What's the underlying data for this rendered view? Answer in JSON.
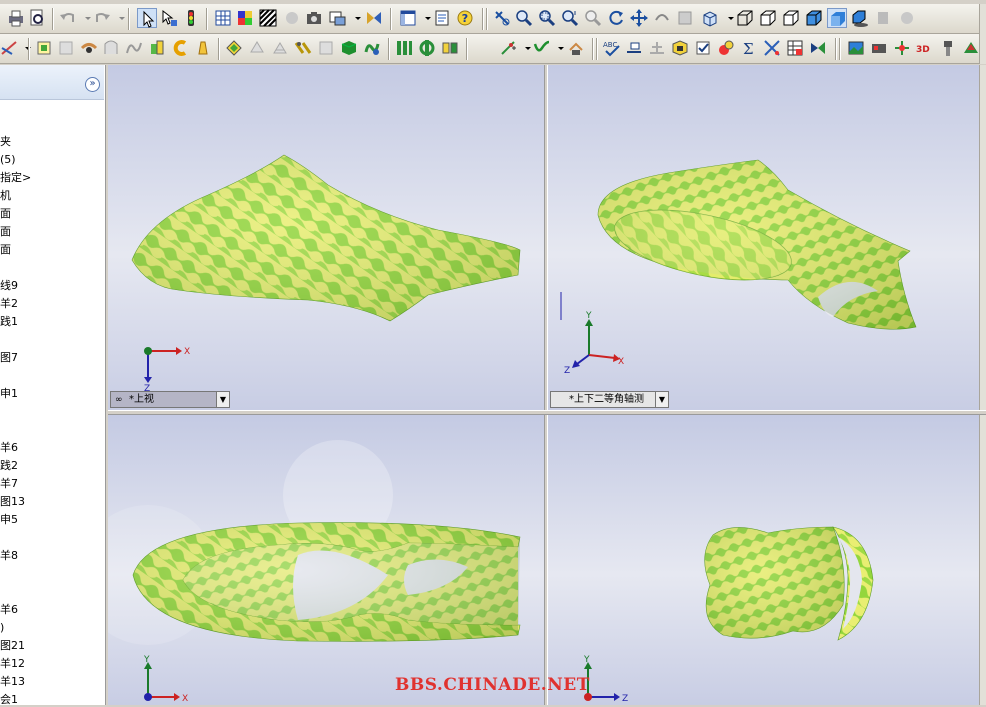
{
  "feature_tree": {
    "items": [
      "夹",
      "(5)",
      "指定>",
      "机",
      "面",
      "面",
      "面",
      "线9",
      "羊2",
      "践1",
      "图7",
      "申1",
      "羊6",
      "践2",
      "羊7",
      "图13",
      "申5",
      "羊8",
      "羊6",
      ")",
      "图21",
      "羊12",
      "羊13",
      "会1"
    ]
  },
  "viewports": {
    "top_left": {
      "label": "*上视"
    },
    "top_right": {
      "label": "*上下二等角轴测"
    }
  },
  "triad": {
    "x": "X",
    "y": "Y",
    "z": "Z"
  },
  "watermark": "BBS.CHINADE.NET",
  "colors": {
    "surface_green": "#8fd63a",
    "surface_yellow": "#e8ec6a",
    "viewport_bg_top": "#c9cfe6",
    "viewport_bg_bottom": "#eef0f6"
  }
}
